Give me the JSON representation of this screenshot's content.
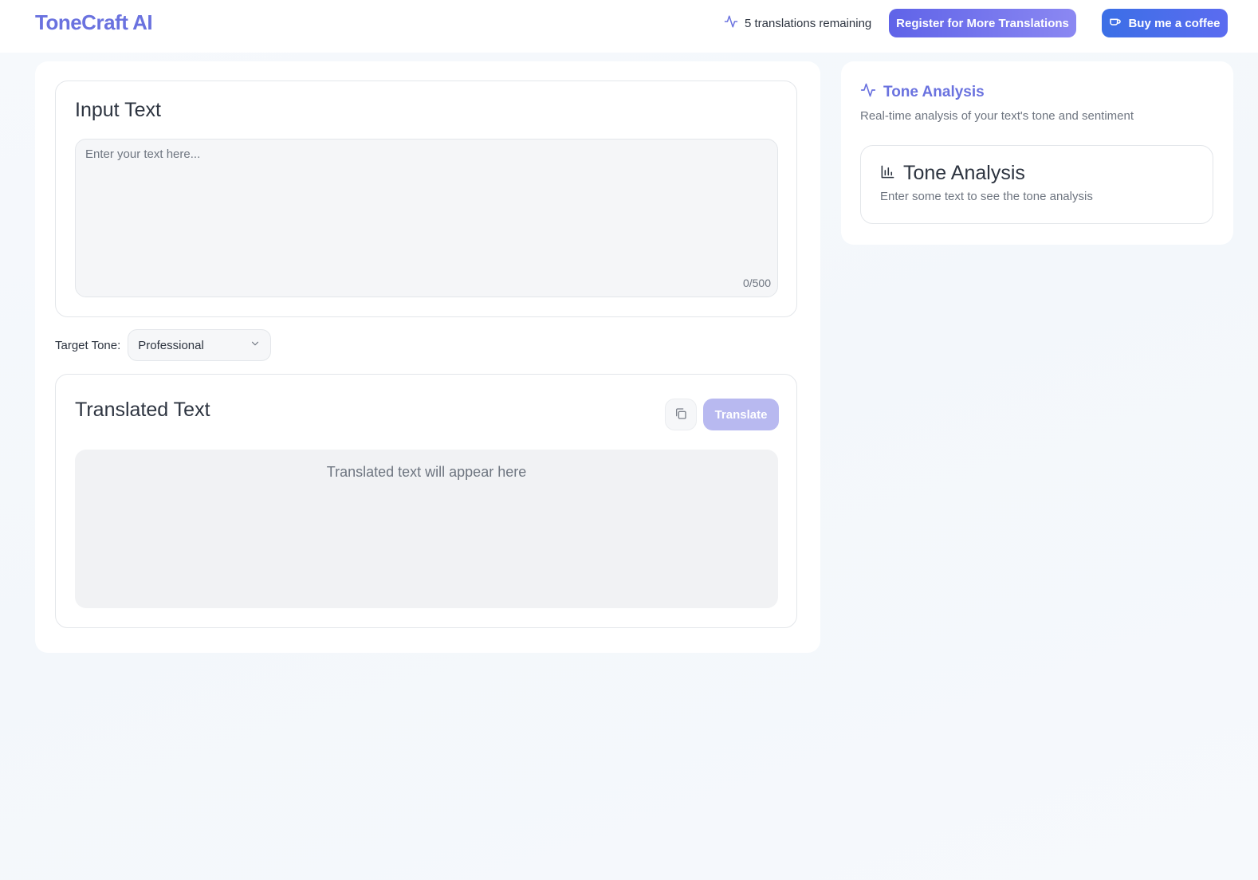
{
  "header": {
    "brand": "ToneCraft AI",
    "remaining_text": "5 translations remaining",
    "register_label": "Register for More Translations",
    "coffee_label": "Buy me a coffee"
  },
  "input": {
    "title": "Input Text",
    "placeholder": "Enter your text here...",
    "value": "",
    "counter": "0/500"
  },
  "tone": {
    "label": "Target Tone:",
    "selected": "Professional"
  },
  "output": {
    "title": "Translated Text",
    "translate_label": "Translate",
    "placeholder": "Translated text will appear here"
  },
  "analysis": {
    "panel_title": "Tone Analysis",
    "panel_subtitle": "Real-time analysis of your text's tone and sentiment",
    "card_title": "Tone Analysis",
    "card_message": "Enter some text to see the tone analysis"
  },
  "icons": {
    "remaining": "activity-icon",
    "coffee": "coffee-cup-icon",
    "select": "chevron-down-icon",
    "copy": "copy-icon",
    "panel": "activity-icon",
    "card": "bar-chart-icon"
  },
  "colors": {
    "brand": "#6a72df",
    "register_start": "#5f63e8",
    "register_end": "#8b88f2",
    "coffee_start": "#3b6fe6",
    "coffee_end": "#5b6cf0",
    "translate_disabled": "#b8b9f0"
  }
}
